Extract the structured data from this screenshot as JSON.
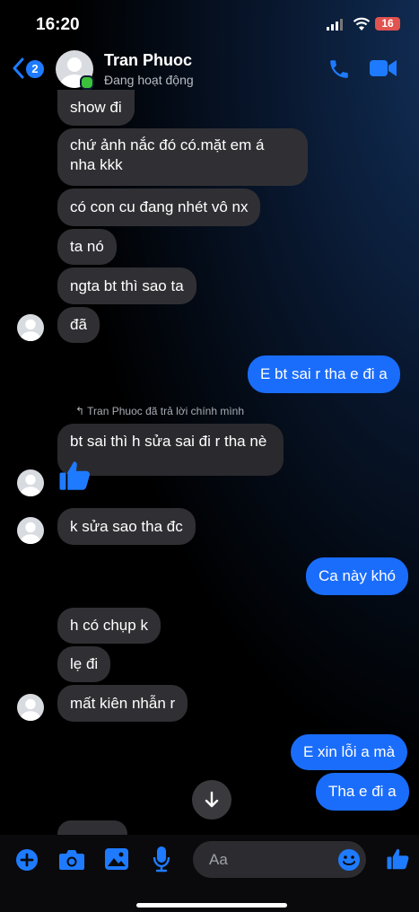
{
  "status_bar": {
    "time": "16:20",
    "battery": "16"
  },
  "header": {
    "back_badge": "2",
    "name": "Tran Phuoc",
    "status": "Đang hoạt động"
  },
  "messages": {
    "m1": "show đi",
    "m2a": "chứ ảnh nắc đó có.mặt em á",
    "m2b": "nha kkk",
    "m3": "có con cu đang nhét vô nx",
    "m4": "ta nó",
    "m5": "ngta bt thì sao ta",
    "m6": "đã",
    "m7": "E bt sai r tha e đi a",
    "reply_note": "Tran Phuoc đã trả lời chính mình",
    "m8": "bt sai thì h sửa sai đi r tha nè",
    "m9": "k sửa sao tha đc",
    "m10": "Ca này khó",
    "m11": "h có chụp k",
    "m12": "lẹ đi",
    "m13": "mất kiên nhẫn r",
    "m14": "E xin lỗi a mà",
    "m15": "Tha e đi a"
  },
  "composer": {
    "placeholder": "Aa"
  },
  "colors": {
    "accent": "#1a6dfb",
    "incoming_bubble": "#303034",
    "online": "#3cc13b"
  },
  "icons": [
    "back-chevron-icon",
    "phone-icon",
    "video-camera-icon",
    "plus-icon",
    "camera-icon",
    "gallery-icon",
    "microphone-icon",
    "emoji-icon",
    "thumbs-up-icon",
    "arrow-down-icon"
  ]
}
